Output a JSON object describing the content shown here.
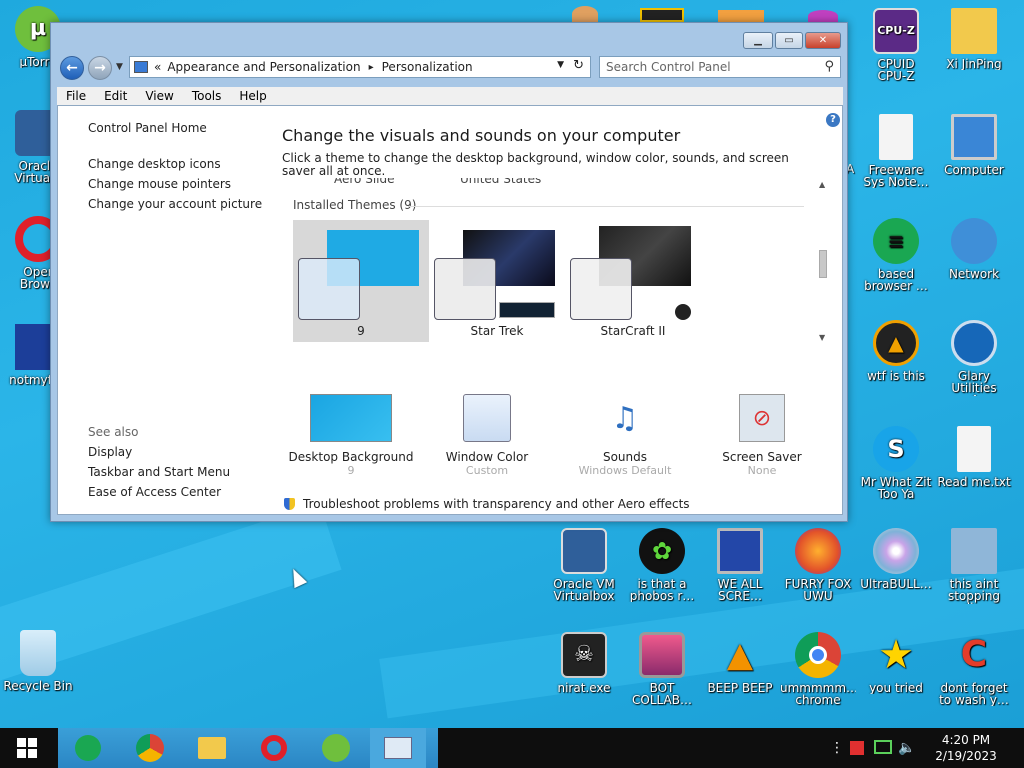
{
  "desktop": {
    "icons_left": [
      {
        "label": "µTorre",
        "id": "utorrent"
      },
      {
        "label": "Oracle\nVirtualB",
        "id": "virtualbox-left"
      },
      {
        "label": "Oper\nBrows",
        "id": "opera"
      },
      {
        "label": "notmyfau",
        "id": "notmyfault"
      },
      {
        "label": "Recycle Bin",
        "id": "recycle-bin"
      }
    ],
    "icons_right_col1": [
      {
        "label": "CPUID\nCPU-Z",
        "id": "cpuz"
      },
      {
        "label": "Freeware\nSys Note…",
        "id": "freeware"
      },
      {
        "label": "based\nbrowser …",
        "id": "based-browser"
      },
      {
        "label": "wtf is this",
        "id": "wtf"
      },
      {
        "label": "Mr What Zit\nToo Ya",
        "id": "mr-what"
      }
    ],
    "icons_right_col2": [
      {
        "label": "Xi JinPing",
        "id": "xi"
      },
      {
        "label": "Computer",
        "id": "computer"
      },
      {
        "label": "Network",
        "id": "network"
      },
      {
        "label": "Glary Utilities\n4",
        "id": "glary"
      },
      {
        "label": "Read me.txt",
        "id": "readme"
      }
    ],
    "icons_bottom_row1": [
      {
        "label": "Oracle VM\nVirtualbox",
        "id": "vbox"
      },
      {
        "label": "is that a\nphobos r…",
        "id": "phobos"
      },
      {
        "label": "WE ALL\nSCRE…",
        "id": "we-all"
      },
      {
        "label": "FURRY FOX\nUWU",
        "id": "furry-fox"
      },
      {
        "label": "UltraBULL…",
        "id": "ultrabull"
      },
      {
        "label": "this aint\nstopping di…",
        "id": "stopping"
      }
    ],
    "icons_bottom_row2": [
      {
        "label": "nirat.exe",
        "id": "nirat"
      },
      {
        "label": "BOT\nCOLLAB…",
        "id": "bot-collab"
      },
      {
        "label": "BEEP BEEP",
        "id": "beep"
      },
      {
        "label": "ummmmm…\nchrome",
        "id": "chrome-shortcut"
      },
      {
        "label": "you tried",
        "id": "you-tried"
      },
      {
        "label": "dont forget\nto wash y…",
        "id": "wash"
      }
    ],
    "partial_label": "A"
  },
  "window": {
    "breadcrumb_prefix": "«",
    "crumb1": "Appearance and Personalization",
    "crumb_sep": "▸",
    "crumb2": "Personalization",
    "search_placeholder": "Search Control Panel",
    "menu": [
      "File",
      "Edit",
      "View",
      "Tools",
      "Help"
    ],
    "left_links": [
      "Control Panel Home",
      "Change desktop icons",
      "Change mouse pointers",
      "Change your account picture"
    ],
    "see_also_title": "See also",
    "see_also": [
      "Display",
      "Taskbar and Start Menu",
      "Ease of Access Center"
    ],
    "heading": "Change the visuals and sounds on your computer",
    "description": "Click a theme to change the desktop background, window color, sounds, and screen saver all at once.",
    "cutoff_items": [
      "Aero Slide",
      "United States"
    ],
    "installed_themes": "Installed Themes (9)",
    "themes": [
      "9",
      "Star Trek",
      "StarCraft II"
    ],
    "bottom": [
      {
        "label": "Desktop Background",
        "sub": "9"
      },
      {
        "label": "Window Color",
        "sub": "Custom"
      },
      {
        "label": "Sounds",
        "sub": "Windows Default"
      },
      {
        "label": "Screen Saver",
        "sub": "None"
      }
    ],
    "troubleshoot": "Troubleshoot problems with transparency and other Aero effects"
  },
  "taskbar": {
    "time": "4:20 PM",
    "date": "2/19/2023"
  }
}
